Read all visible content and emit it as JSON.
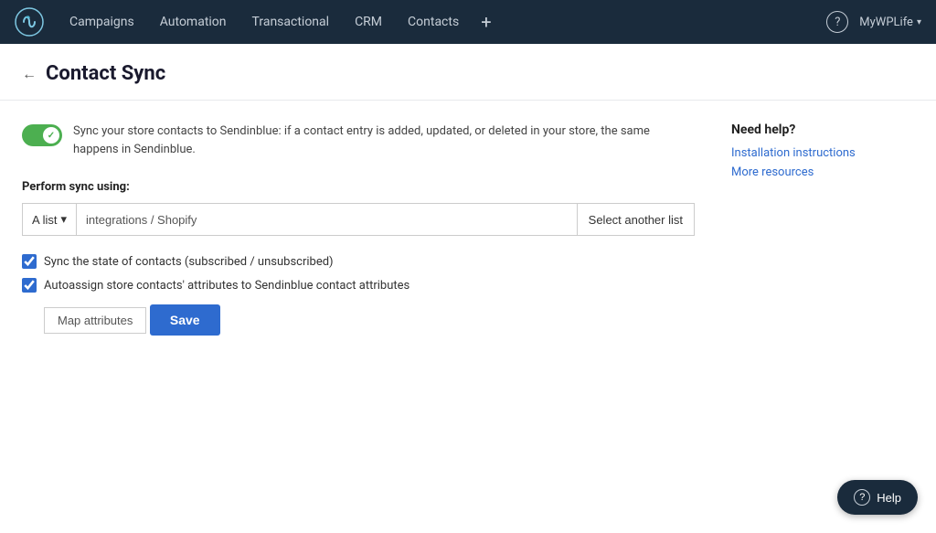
{
  "navbar": {
    "logo_alt": "Sendinblue logo",
    "items": [
      {
        "id": "campaigns",
        "label": "Campaigns"
      },
      {
        "id": "automation",
        "label": "Automation"
      },
      {
        "id": "transactional",
        "label": "Transactional"
      },
      {
        "id": "crm",
        "label": "CRM"
      },
      {
        "id": "contacts",
        "label": "Contacts"
      }
    ],
    "plus_label": "+",
    "help_icon": "?",
    "user_name": "MyWPLife",
    "user_caret": "▾"
  },
  "page": {
    "back_label": "←",
    "title": "Contact Sync"
  },
  "sync_section": {
    "description": "Sync your store contacts to Sendinblue: if a contact entry is added, updated, or deleted in your store, the same happens in Sendinblue.",
    "perform_label": "Perform sync using:",
    "list_button_label": "A list",
    "list_value": "integrations / Shopify",
    "select_another_label": "Select another list",
    "checkbox1_label": "Sync the state of contacts (subscribed / unsubscribed)",
    "checkbox2_label": "Autoassign store contacts' attributes to Sendinblue contact attributes",
    "map_attributes_label": "Map attributes",
    "save_label": "Save"
  },
  "help_sidebar": {
    "title": "Need help?",
    "links": [
      {
        "label": "Installation instructions"
      },
      {
        "label": "More resources"
      }
    ]
  },
  "help_float": {
    "icon": "?",
    "label": "Help"
  }
}
